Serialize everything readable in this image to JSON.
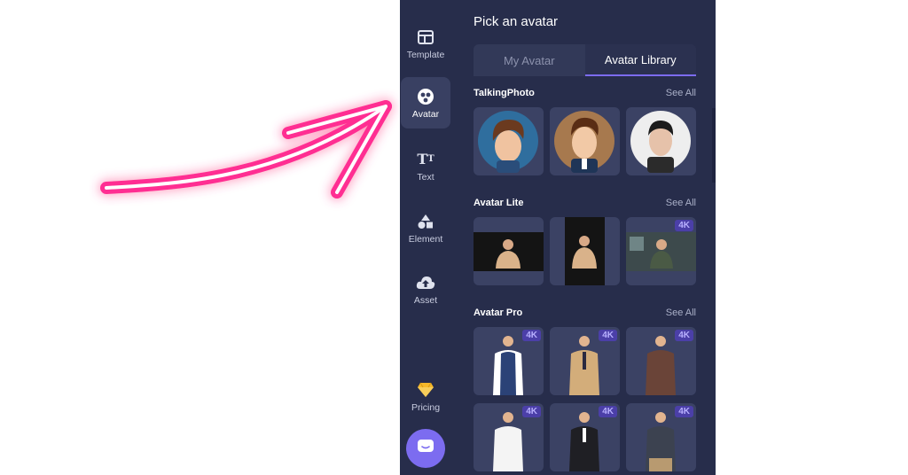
{
  "sidebar": {
    "items": [
      {
        "label": "Template",
        "icon": "template-icon"
      },
      {
        "label": "Avatar",
        "icon": "avatar-icon",
        "active": true
      },
      {
        "label": "Text",
        "icon": "text-icon"
      },
      {
        "label": "Element",
        "icon": "element-icon"
      },
      {
        "label": "Asset",
        "icon": "upload-cloud-icon"
      }
    ],
    "pricing": {
      "label": "Pricing",
      "icon": "diamond-icon"
    },
    "chat_icon": "chat-bubble-icon"
  },
  "panel": {
    "title": "Pick an avatar",
    "tabs": [
      {
        "label": "My Avatar",
        "active": false
      },
      {
        "label": "Avatar Library",
        "active": true
      }
    ],
    "sections": [
      {
        "title": "TalkingPhoto",
        "see_all": "See All"
      },
      {
        "title": "Avatar Lite",
        "see_all": "See All",
        "badges": [
          "",
          "",
          "4K"
        ]
      },
      {
        "title": "Avatar Pro",
        "see_all": "See All",
        "badges": [
          "4K",
          "4K",
          "4K",
          "4K",
          "4K",
          "4K"
        ]
      }
    ]
  },
  "colors": {
    "panel_bg": "#272d4b",
    "accent": "#7c6cf0",
    "annotation_arrow": "#ff2f92"
  }
}
